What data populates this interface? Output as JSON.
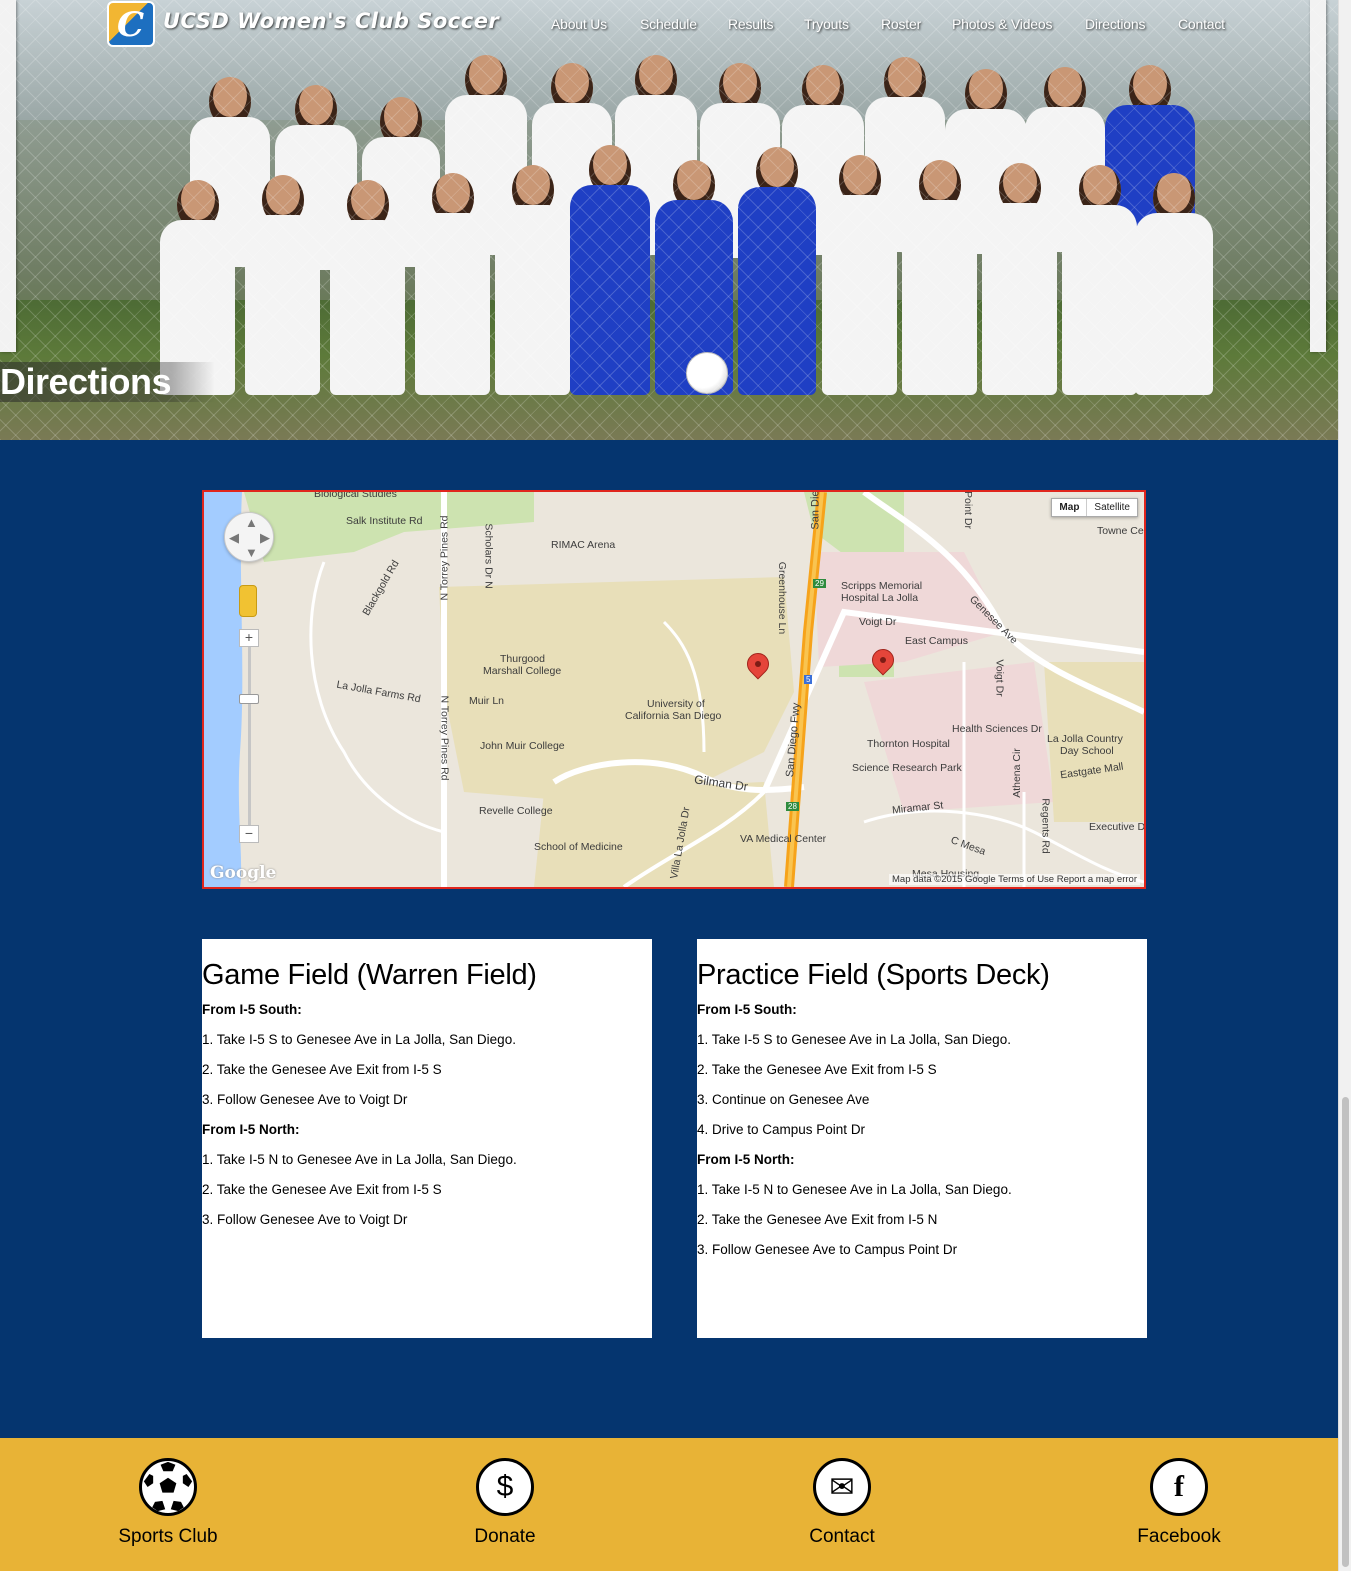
{
  "site": {
    "title": "UCSD Women's Club Soccer",
    "logo_letter": "C"
  },
  "nav": [
    {
      "label": "About Us"
    },
    {
      "label": "Schedule"
    },
    {
      "label": "Results"
    },
    {
      "label": "Tryouts"
    },
    {
      "label": "Roster"
    },
    {
      "label": "Photos & Videos"
    },
    {
      "label": "Directions"
    },
    {
      "label": "Contact"
    }
  ],
  "page": {
    "heading": "Directions"
  },
  "map": {
    "type_buttons": [
      "Map",
      "Satellite"
    ],
    "labels": {
      "biological": "Biological Studies",
      "salk": "Salk Institute Rd",
      "rimac": "RIMAC Arena",
      "scripps": "Scripps Memorial",
      "scripps2": "Hospital La Jolla",
      "voigt": "Voigt Dr",
      "east_campus": "East Campus",
      "genesee": "Genesee Ave",
      "thurgood": "Thurgood",
      "marshall": "Marshall College",
      "university": "University of",
      "ucsd": "California San Diego",
      "muir_ln": "Muir Ln",
      "john_muir": "John Muir College",
      "la_jolla_farms": "La Jolla Farms Rd",
      "blackgold": "Blackgold Rd",
      "n_torrey": "N Torrey Pines Rd",
      "scholars": "Scholars Dr N",
      "thornton": "Thornton Hospital",
      "science": "Science Research Park",
      "health": "Health Sciences Dr",
      "country_day": "La Jolla Country",
      "country_day2": "Day School",
      "eastgate": "Eastgate Mall",
      "gilman": "Gilman Dr",
      "miramar": "Miramar St",
      "revelle": "Revelle College",
      "medicine": "School of Medicine",
      "va": "VA Medical Center",
      "executive": "Executive Dr",
      "towne": "Towne Cen",
      "sd_fwy": "San Diego Fwy",
      "greenhouse": "Greenhouse Ln",
      "athena": "Athena Cir",
      "regents": "Regents Rd",
      "villa": "Villa La Jolla Dr",
      "mesa": "C Mesa",
      "mesa_housing": "Mesa Housing",
      "voigt2": "Voigt Dr",
      "san_die": "San Die",
      "point_dr": "Point Dr",
      "i5": "5",
      "r29": "29",
      "r28": "28"
    },
    "footer": "Map data ©2015 Google   Terms of Use   Report a map error",
    "google": "Google"
  },
  "game_field": {
    "title": "Game Field (Warren Field)",
    "south_heading": "From I-5 South:",
    "south_steps": [
      "1. Take I-5 S to Genesee Ave in La Jolla, San Diego.",
      "2. Take the Genesee Ave Exit from I-5 S",
      "3. Follow Genesee Ave to Voigt Dr"
    ],
    "north_heading": "From I-5 North:",
    "north_steps": [
      "1. Take I-5 N to Genesee Ave in La Jolla, San Diego.",
      "2. Take the Genesee Ave Exit from I-5 S",
      "3. Follow Genesee Ave to Voigt Dr"
    ]
  },
  "practice_field": {
    "title": "Practice Field (Sports Deck)",
    "south_heading": "From I-5 South:",
    "south_steps": [
      "1. Take I-5 S to Genesee Ave in La Jolla, San Diego.",
      "2. Take the Genesee Ave Exit from I-5 S",
      "3. Continue on Genesee Ave",
      "4. Drive to Campus Point Dr"
    ],
    "north_heading": "From I-5 North:",
    "north_steps": [
      "1. Take I-5 N to Genesee Ave in La Jolla, San Diego.",
      "2. Take the Genesee Ave Exit from I-5 N",
      "3. Follow Genesee Ave to Campus Point Dr"
    ]
  },
  "footer": {
    "items": [
      {
        "label": "Sports Club",
        "icon": "soccer-ball-icon"
      },
      {
        "label": "Donate",
        "icon": "dollar-icon",
        "glyph": "$"
      },
      {
        "label": "Contact",
        "icon": "envelope-icon",
        "glyph": "✉"
      },
      {
        "label": "Facebook",
        "icon": "facebook-icon",
        "glyph": "f"
      }
    ]
  },
  "colors": {
    "background": "#05356f",
    "footer": "#e8b336",
    "map_border": "#e0261d"
  }
}
